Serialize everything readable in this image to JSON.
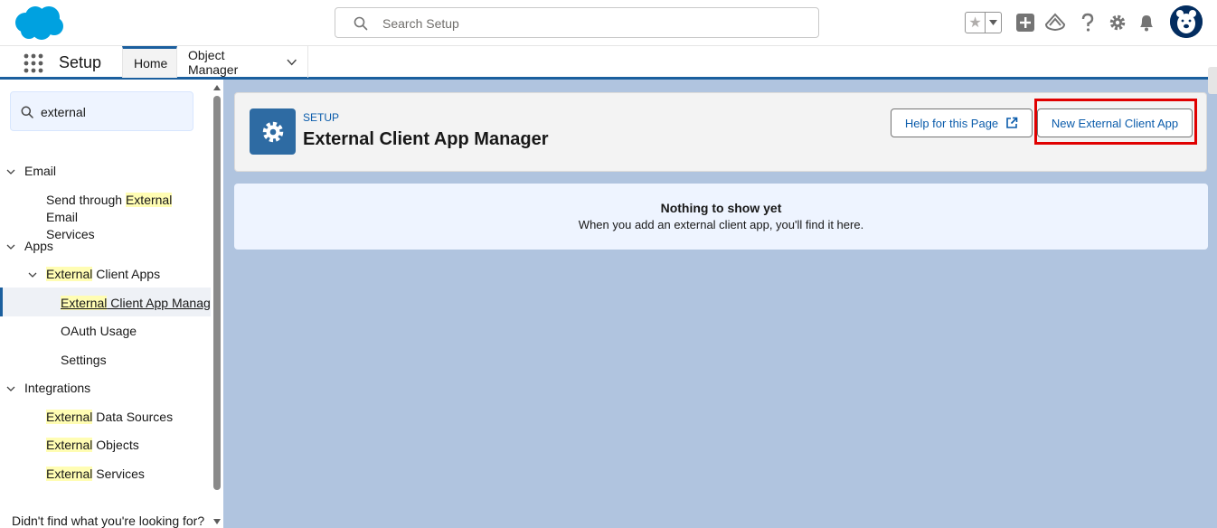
{
  "header": {
    "search": {
      "placeholder": "Search Setup"
    },
    "icons": [
      "salesforce-logo",
      "search-icon",
      "favorites-star-icon",
      "chevron-down-icon",
      "add-icon",
      "trailhead-icon",
      "help-icon",
      "gear-icon",
      "bell-icon",
      "avatar"
    ]
  },
  "context_bar": {
    "app_name": "Setup",
    "tabs": [
      {
        "label": "Home",
        "active": true
      },
      {
        "label": "Object Manager",
        "has_dropdown": true
      }
    ]
  },
  "sidebar": {
    "quick_find": {
      "value": "external"
    },
    "tree": {
      "email": {
        "label": "Email"
      },
      "email_child": {
        "pre": "Send through ",
        "match": "External",
        "post": " Email",
        "line2": "Services"
      },
      "apps": {
        "label": "Apps"
      },
      "apps_child": {
        "match": "External",
        "post": " Client Apps"
      },
      "eca_manager": {
        "match": "External",
        "post": " Client App Manager"
      },
      "oauth_usage": {
        "label": "OAuth Usage"
      },
      "settings": {
        "label": "Settings"
      },
      "integrations": {
        "label": "Integrations"
      },
      "data_sources": {
        "match": "External",
        "post": " Data Sources"
      },
      "objects": {
        "match": "External",
        "post": " Objects"
      },
      "services": {
        "match": "External",
        "post": " Services"
      }
    },
    "footer": "Didn't find what you're looking for?"
  },
  "main": {
    "eyebrow": "SETUP",
    "title": "External Client App Manager",
    "help_button": "Help for this Page",
    "new_button": "New External Client App",
    "empty_title": "Nothing to show yet",
    "empty_subtitle": "When you add an external client app, you'll find it here."
  },
  "colors": {
    "brand_blue": "#0b5cab",
    "main_background": "#b0c4df",
    "highlight_box": "#e00000",
    "search_match": "#fffdb3"
  }
}
